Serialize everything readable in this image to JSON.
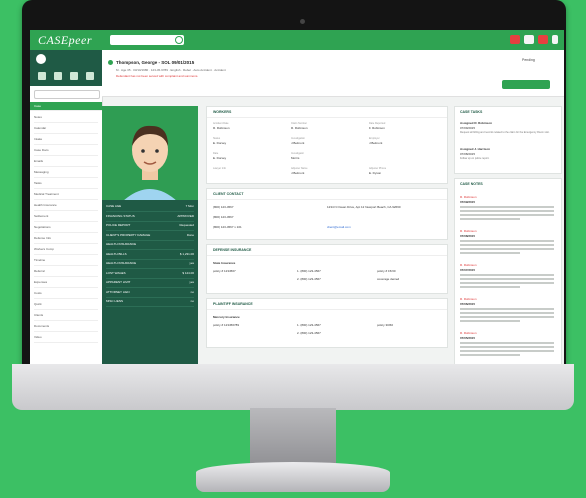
{
  "app": {
    "logo": "CASEpeer",
    "sidebar_items": [
      "Case",
      "Notes",
      "Calendar",
      "Intake",
      "Case Docs",
      "Emails",
      "Messaging",
      "Tasks",
      "Medical Treatment",
      "Health Insurance",
      "Settlement",
      "Negotiations",
      "Defense Info",
      "Workers Comp",
      "Timeline",
      "Referral",
      "Expenses",
      "Costs",
      "Quick",
      "Clients",
      "Documents",
      "Video"
    ]
  },
  "header": {
    "title": "Thompson, George - SOL 09/01/2015",
    "breadcrumb": "M · Age 35 · 03/10/1980 · 123-45-6789 · English · Rebel · Auto Accident · Accident",
    "alert": "Defendant has not been served with complaint and summons.",
    "status": "Pending",
    "save_label": "SAVE"
  },
  "facts": [
    {
      "label": "CASE AGE",
      "value": "7 Mon"
    },
    {
      "label": "FINANCING STATUS",
      "value": "APPROVED"
    },
    {
      "label": "POLICE REPORT",
      "value": "Requested"
    },
    {
      "label": "CLIENT'S PROPERTY DAMAGE",
      "value": "Done"
    },
    {
      "label": "HEALTH INSURANCE",
      "value": ""
    },
    {
      "label": "HEALTH BILLS",
      "value": "$ 1,231.00"
    },
    {
      "label": "HEALTH INSURANCE",
      "value": "yes"
    },
    {
      "label": "LOST WAGES",
      "value": "$ 124.00"
    },
    {
      "label": "APPARENT LIMIT",
      "value": "yes"
    },
    {
      "label": "ATTORNEY LIEN",
      "value": "no"
    },
    {
      "label": "MISC LIENS",
      "value": "no"
    }
  ],
  "cards": {
    "workers": {
      "title": "WORKERS",
      "rows": [
        [
          "Accident Date",
          "R. Robinson",
          "Claim Number",
          "R. Robinson",
          "Date Reported",
          "F. Robinson"
        ],
        [
          "Status",
          "E. Dorsey",
          "Investigation",
          "J.Belmont",
          "Employer",
          "J.Belmont"
        ],
        [
          "Date",
          "E. Dorsey",
          "Investigator",
          "Morris",
          "",
          ""
        ],
        [
          "Lawyer Info",
          "",
          "Adjuster Name",
          "J.Belmont",
          "Adjuster Phone",
          "E. Dyson"
        ]
      ]
    },
    "client_contact": {
      "title": "CLIENT CONTACT",
      "cell": "(800) 123-4567",
      "home": "(800) 123-4567",
      "work": "(800) 123-4567 x 101",
      "address": "1234 N Ocean Drive, Apt 12 Newport Beach, CA 92660",
      "email": "client@email.com"
    },
    "defense": {
      "title": "DEFENSE INSURANCE",
      "company": "State Insurance",
      "policy": "policy # 1234567",
      "phone1": "1. (800) 123-4567",
      "phone2": "2. (800) 123-4567",
      "limits": "policy # 15/30",
      "limit2": "coverage denied"
    },
    "plaintiff": {
      "title": "PLAINTIFF INSURANCE",
      "company": "Mercury Insurance",
      "policy": "policy # 123456789",
      "phone1": "1. (800) 123-4567",
      "phone2": "2. (800) 123-4567",
      "limits": "policy 30/60"
    }
  },
  "right_panel": {
    "case_tasks_title": "CASE TASKS",
    "tasks": [
      {
        "name": "Assigned R. Robinson",
        "date": "07/09/2015",
        "text": "Request all billing and records related to the claim for the Emergency Room visit."
      },
      {
        "name": "Assigned J. Harrison",
        "date": "07/08/2015",
        "text": "Follow up on police report."
      }
    ],
    "case_notes_title": "CASE NOTES",
    "notes": [
      {
        "name": "R. Robinson",
        "date": "07/09/2015"
      },
      {
        "name": "R. Robinson",
        "date": "07/08/2015"
      },
      {
        "name": "R. Robinson",
        "date": "07/07/2015"
      },
      {
        "name": "R. Robinson",
        "date": "07/06/2015"
      },
      {
        "name": "R. Robinson",
        "date": "07/05/2015"
      }
    ]
  },
  "colors": {
    "brand_green": "#2fa352",
    "dark_green": "#1f5a45",
    "background": "#3cc064"
  }
}
